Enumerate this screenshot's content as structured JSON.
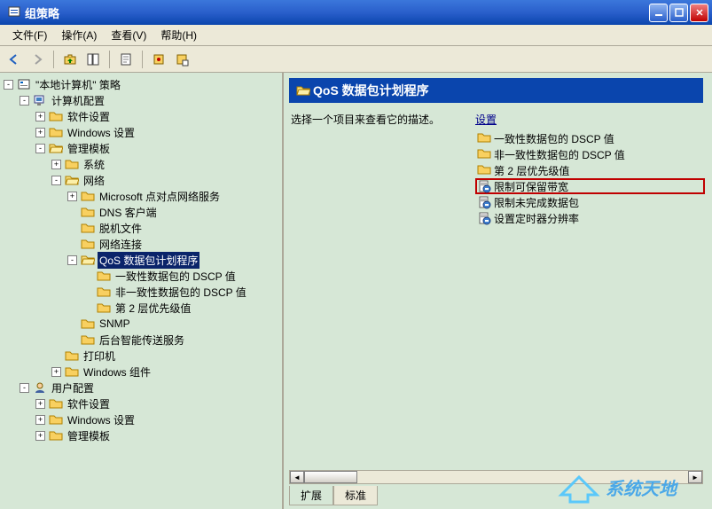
{
  "titlebar": {
    "title": "组策略"
  },
  "menu": {
    "file": "文件(F)",
    "action": "操作(A)",
    "view": "查看(V)",
    "help": "帮助(H)"
  },
  "tree": {
    "root": "\"本地计算机\" 策略",
    "computer": "计算机配置",
    "sw": "软件设置",
    "winset": "Windows 设置",
    "admintpl": "管理模板",
    "system": "系统",
    "network": "网络",
    "ms_p2p": "Microsoft 点对点网络服务",
    "dns": "DNS 客户端",
    "offline": "脱机文件",
    "netconn": "网络连接",
    "qos": "QoS 数据包计划程序",
    "qos1": "一致性数据包的 DSCP 值",
    "qos2": "非一致性数据包的 DSCP 值",
    "qos3": "第 2 层优先级值",
    "snmp": "SNMP",
    "bgts": "后台智能传送服务",
    "printer": "打印机",
    "wincomp": "Windows 组件",
    "user": "用户配置",
    "usw": "软件设置",
    "uwinset": "Windows 设置",
    "uadmin": "管理模板"
  },
  "right": {
    "title": "QoS 数据包计划程序",
    "desc": "选择一个项目来查看它的描述。",
    "settings_hdr": "设置",
    "items": [
      "一致性数据包的 DSCP 值",
      "非一致性数据包的 DSCP 值",
      "第 2 层优先级值",
      "限制可保留带宽",
      "限制未完成数据包",
      "设置定时器分辨率"
    ]
  },
  "tabs": {
    "extended": "扩展",
    "standard": "标准"
  },
  "watermark": "系统天地"
}
